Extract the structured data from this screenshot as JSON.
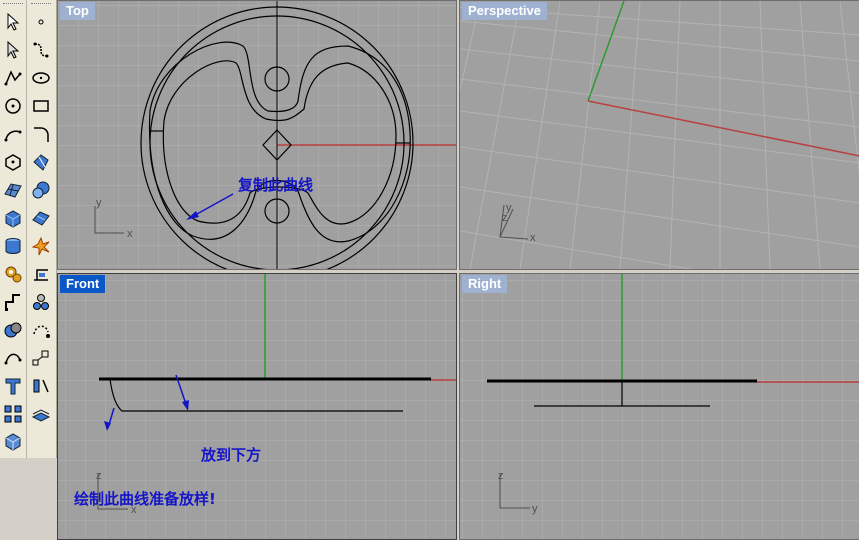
{
  "viewports": {
    "top": {
      "title": "Top"
    },
    "perspective": {
      "title": "Perspective"
    },
    "front": {
      "title": "Front"
    },
    "right": {
      "title": "Right"
    }
  },
  "annotations": {
    "copy_curve": "复制此曲线",
    "place_below": "放到下方",
    "draw_curve_loft": "绘制此曲线准备放样!"
  },
  "axes": {
    "x": "x",
    "y": "y",
    "z": "z"
  },
  "colors": {
    "grid_bg": "#a0a0a0",
    "grid_line": "#b0b0b0",
    "x_axis": "#b84040",
    "y_axis": "#2e9a2e",
    "active_title_bg": "#0a58c8",
    "inactive_title_bg": "#9fb1d0",
    "annotation_text": "#1515c8"
  },
  "toolbar": {
    "left_column": [
      "select-arrow-icon",
      "select-points-icon",
      "polyline-icon",
      "circle-icon",
      "arc-icon",
      "polygon-icon",
      "surface-icon",
      "box-icon",
      "cylinder-icon",
      "transform-gear-icon",
      "move-icon",
      "boolean-icon",
      "curve-tools-icon",
      "text-icon",
      "array-icon",
      "render-icon"
    ],
    "right_column": [
      "point-icon",
      "curve-icon",
      "ellipse-icon",
      "rectangle-icon",
      "fillet-icon",
      "revolve-icon",
      "sphere-icon",
      "plane-surface-icon",
      "explode-icon",
      "dimension-icon",
      "group-icon",
      "analyze-icon",
      "scale-icon",
      "mirror-icon",
      "layer-icon"
    ]
  }
}
